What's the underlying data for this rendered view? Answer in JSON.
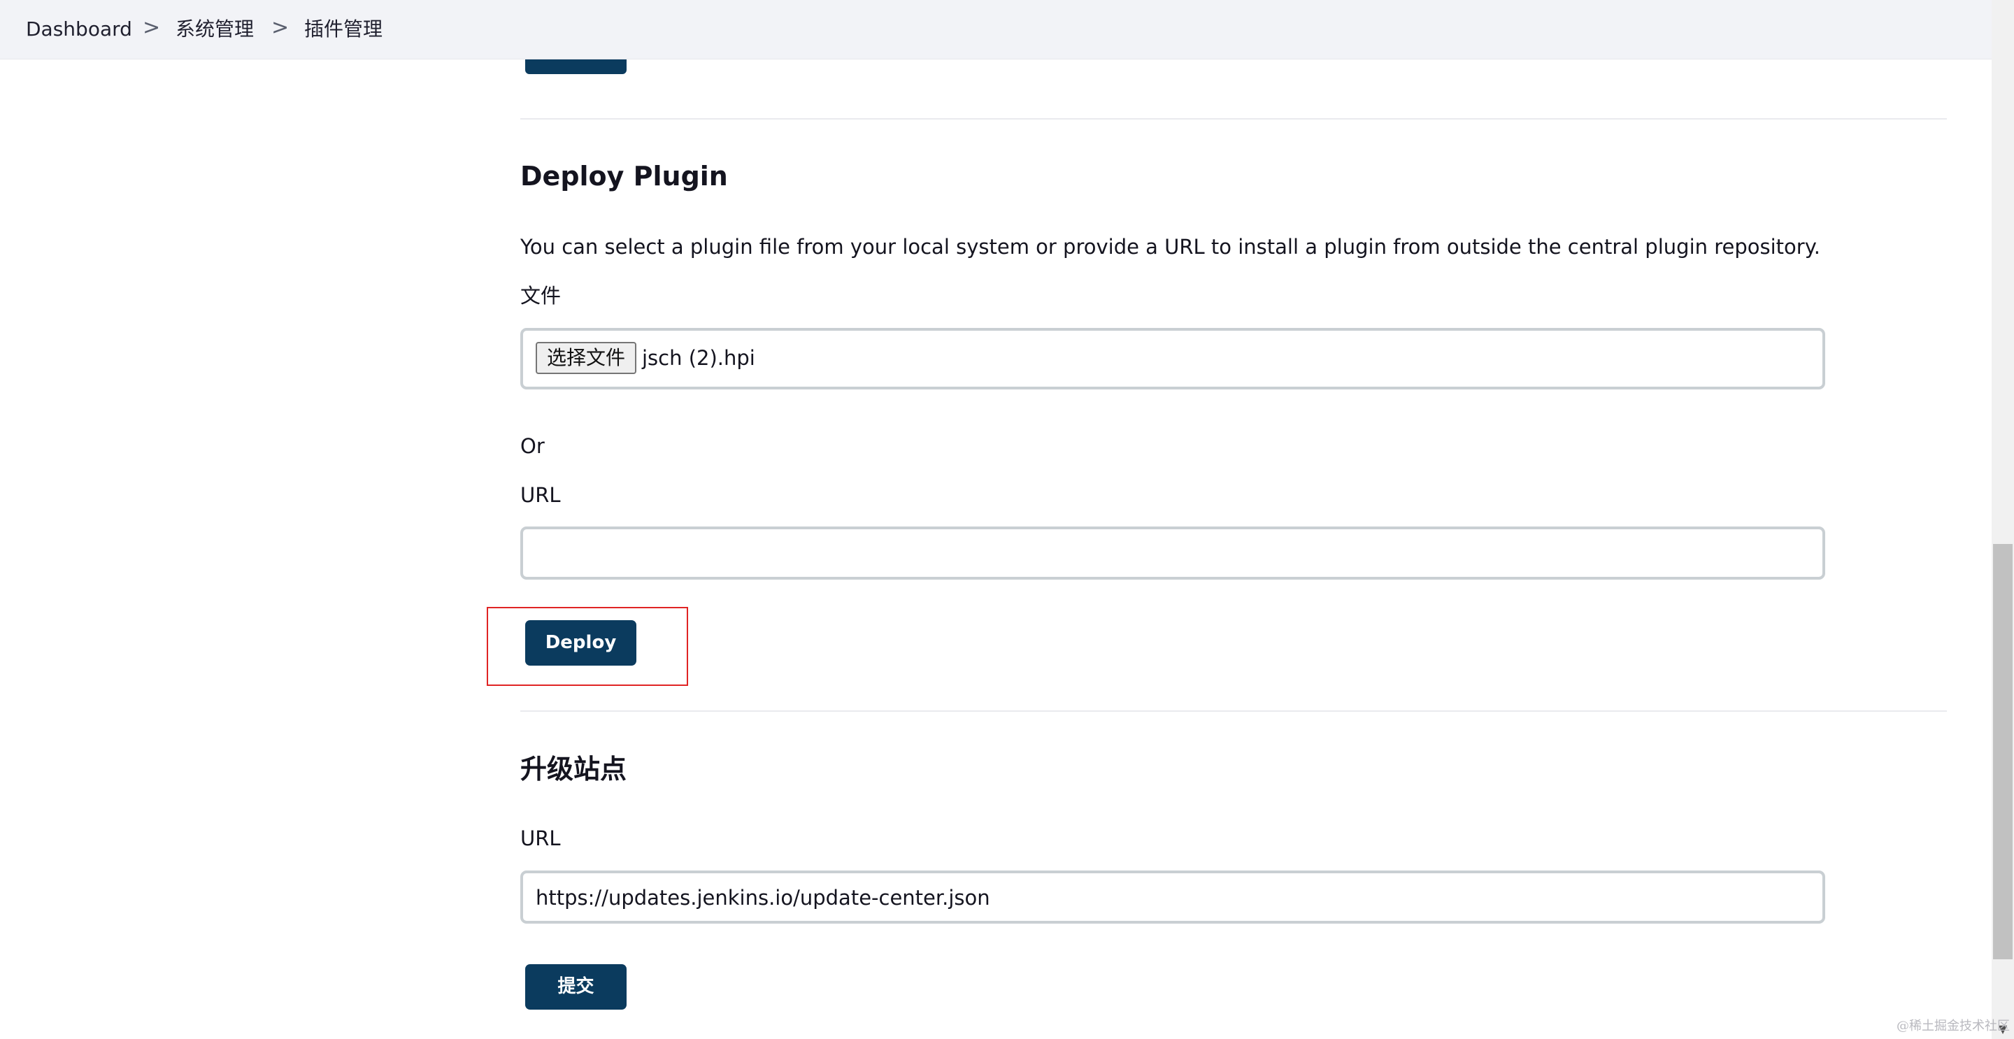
{
  "breadcrumb": {
    "items": [
      "Dashboard",
      "系统管理",
      "插件管理"
    ],
    "separator": ">"
  },
  "deploy": {
    "title": "Deploy Plugin",
    "description": "You can select a plugin file from your local system or provide a URL to install a plugin from outside the central plugin repository.",
    "file_label": "文件",
    "file_button": "选择文件",
    "file_name": "jsch (2).hpi",
    "or_label": "Or",
    "url_label": "URL",
    "url_value": "",
    "deploy_button": "Deploy"
  },
  "update_site": {
    "title": "升级站点",
    "url_label": "URL",
    "url_value": "https://updates.jenkins.io/update-center.json",
    "submit_button": "提交"
  },
  "scrollbar": {
    "up_icon": "▲",
    "down_icon": "▼"
  },
  "watermark": "@稀土掘金技术社区",
  "colors": {
    "primary": "#0b3b5e",
    "highlight": "#e02424",
    "topbar": "#f2f3f7"
  }
}
